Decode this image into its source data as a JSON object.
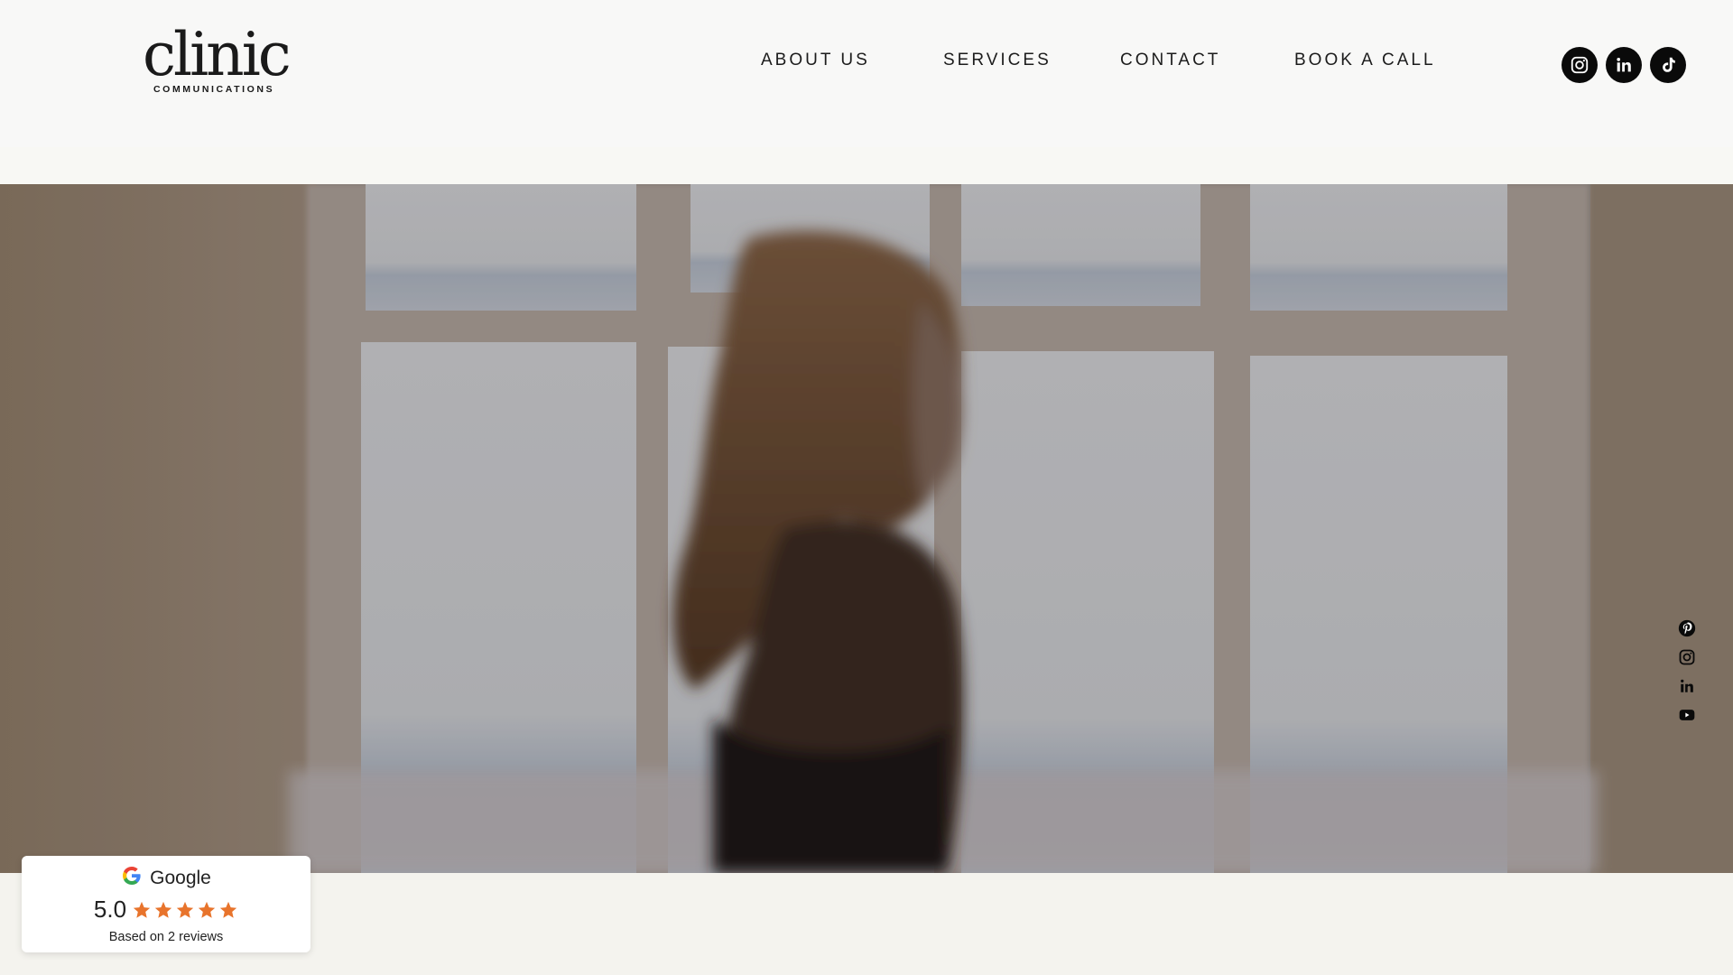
{
  "brand": {
    "name": "clinic",
    "tagline": "COMMUNICATIONS"
  },
  "nav": {
    "items": [
      {
        "label": "ABOUT US"
      },
      {
        "label": "SERVICES"
      },
      {
        "label": "CONTACT"
      },
      {
        "label": "BOOK A CALL"
      }
    ]
  },
  "social_header": [
    "instagram-icon",
    "linkedin-icon",
    "tiktok-icon"
  ],
  "social_side": [
    "pinterest-icon",
    "instagram-icon",
    "linkedin-icon",
    "youtube-icon"
  ],
  "hero": {
    "image": "woman-walking-past-window"
  },
  "review_widget": {
    "brand": "Google",
    "score": "5.0",
    "rating": 5,
    "max_rating": 5,
    "footer": "Based on 2 reviews"
  },
  "colors": {
    "header_bg": "#f8f8f7",
    "page_bg": "#f4f3ee",
    "icon_dark": "#0a0a0a",
    "star_color": "#e8742c"
  }
}
